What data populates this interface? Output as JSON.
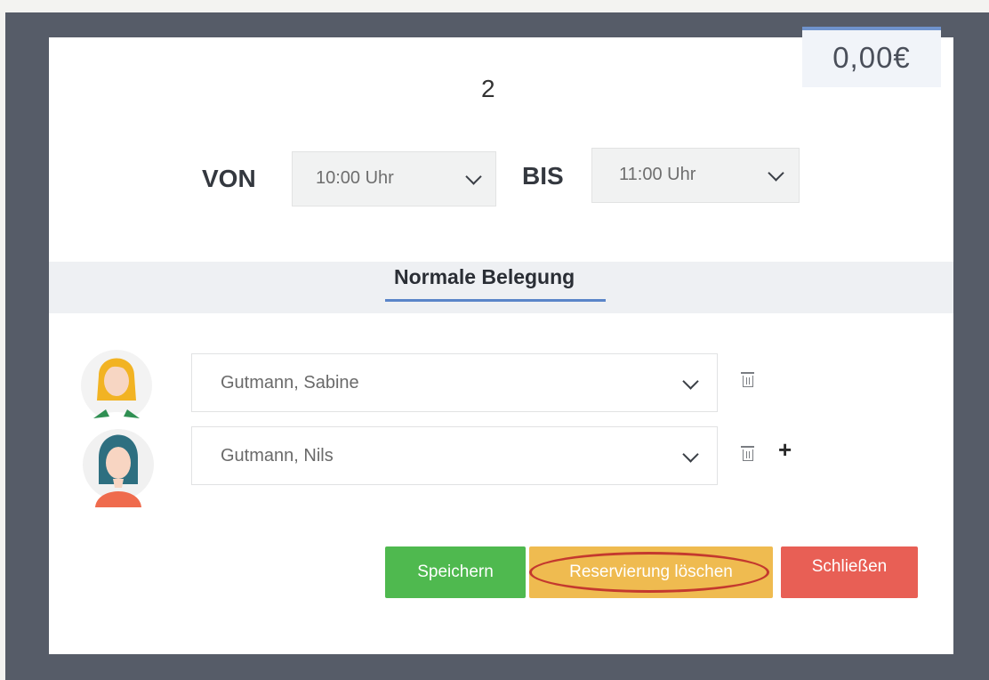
{
  "dialog": {
    "price": "0,00€",
    "count": "2"
  },
  "time": {
    "from_label": "VON",
    "from_value": "10:00 Uhr",
    "to_label": "BIS",
    "to_value": "11:00 Uhr"
  },
  "tabs": [
    {
      "label": "Normale Belegung",
      "active": true
    }
  ],
  "guests": [
    {
      "name": "Gutmann, Sabine",
      "avatar": "female-blonde-avatar"
    },
    {
      "name": "Gutmann, Nils",
      "avatar": "female-teal-hair-avatar"
    }
  ],
  "buttons": {
    "save": "Speichern",
    "delete": "Reservierung löschen",
    "close": "Schließen"
  },
  "colors": {
    "save": "#4fb94f",
    "delete": "#efbb50",
    "close": "#e85f55",
    "accent": "#5a85c9",
    "annotation": "#c4392e"
  },
  "icons": {
    "delete_row": "trash-icon",
    "add_row": "plus-icon",
    "dropdown": "chevron-down-icon"
  }
}
